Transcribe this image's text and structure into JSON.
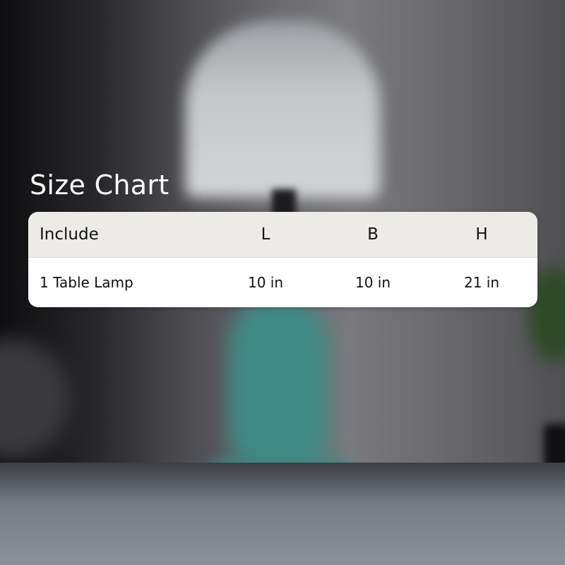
{
  "title": "Size Chart",
  "table": {
    "headers": [
      "Include",
      "L",
      "B",
      "H"
    ],
    "rows": [
      [
        "1 Table Lamp",
        "10 in",
        "10 in",
        "21 in"
      ]
    ]
  }
}
